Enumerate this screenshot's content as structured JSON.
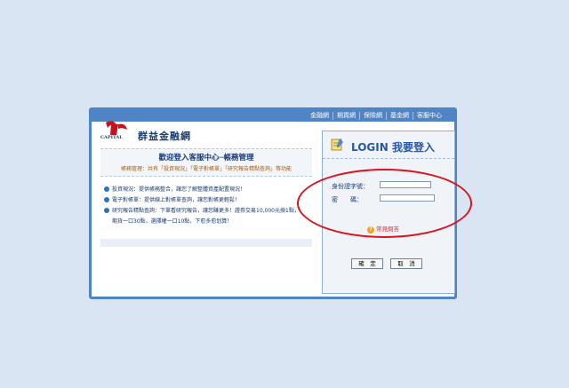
{
  "topnav": [
    "金融網",
    "期貨網",
    "保險網",
    "基金網",
    "客服中心"
  ],
  "brand": {
    "name": "群益金融網",
    "sub": "CAPITAL"
  },
  "welcome": {
    "title": "歡迎登入客服中心─帳務管理",
    "subtitle": "帳務管理：共有「投資現況」「電子對帳單」「研究報告精點查詢」等功能"
  },
  "features": [
    "投資現況：提供帳務整合，讓您了解整體資產配置現況！",
    "電子對帳單：提供線上對帳單查詢，讓您對帳更輕鬆！",
    "研究報告精點查詢：下單看研究報告，讓您賺更多！證券交易10,000元換1點，",
    "期貨一口30點，選擇權一口10點，下愈多愈划算！"
  ],
  "login": {
    "title": "LOGIN 我要登入",
    "id_label": "身份證字號：",
    "pw_label": "密　　碼：",
    "help": "常見問答",
    "ok": "確　定",
    "cancel": "取　消"
  },
  "colors": {
    "frame": "#4f85c6",
    "annotation": "#d9141f"
  }
}
